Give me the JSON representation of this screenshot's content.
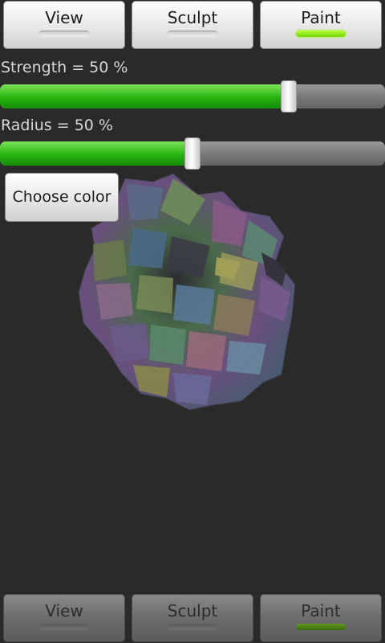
{
  "mode_buttons": {
    "view_label": "View",
    "sculpt_label": "Sculpt",
    "paint_label": "Paint",
    "active": "Paint"
  },
  "strength": {
    "label": "Strength = 50 %",
    "value_fraction": 0.75
  },
  "radius": {
    "label": "Radius = 50 %",
    "value_fraction": 0.5
  },
  "choose_color_label": "Choose color",
  "bottom_buttons": {
    "view_label": "View",
    "sculpt_label": "Sculpt",
    "paint_label": "Paint",
    "active": "Paint"
  },
  "colors": {
    "background": "#2a2a2a",
    "slider_fill": "#25b40e",
    "indicator_on": "#8cff00"
  }
}
